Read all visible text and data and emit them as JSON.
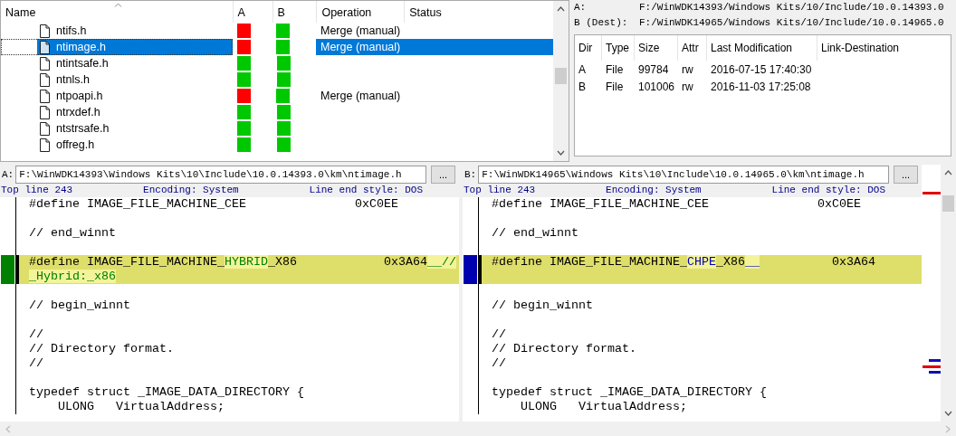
{
  "file_list": {
    "columns": [
      "Name",
      "A",
      "B",
      "Operation",
      "Status"
    ],
    "rows": [
      {
        "name": "ntifs.h",
        "a": {
          "color": "#ff0000"
        },
        "b": {
          "color": "#00c800"
        },
        "operation": "Merge (manual)",
        "selected": false
      },
      {
        "name": "ntimage.h",
        "a": {
          "color": "#ff0000"
        },
        "b": {
          "color": "#00c800"
        },
        "operation": "Merge (manual)",
        "selected": true
      },
      {
        "name": "ntintsafe.h",
        "a": {
          "color": "#00c800"
        },
        "b": {
          "color": "#00c800"
        },
        "selected": false
      },
      {
        "name": "ntnls.h",
        "a": {
          "color": "#00c800"
        },
        "b": {
          "color": "#00c800"
        },
        "selected": false
      },
      {
        "name": "ntpoapi.h",
        "a": {
          "color": "#ff0000"
        },
        "b": {
          "color": "#00c800"
        },
        "operation": "Merge (manual)",
        "selected": false
      },
      {
        "name": "ntrxdef.h",
        "a": {
          "color": "#00c800"
        },
        "b": {
          "color": "#00c800"
        },
        "selected": false
      },
      {
        "name": "ntstrsafe.h",
        "a": {
          "color": "#00c800"
        },
        "b": {
          "color": "#00c800"
        },
        "selected": false
      },
      {
        "name": "offreg.h",
        "a": {
          "color": "#00c800"
        },
        "b": {
          "color": "#00c800"
        },
        "selected": false
      }
    ]
  },
  "info": {
    "a_label": "A:",
    "a_path": "F:/WinWDK14393/Windows Kits/10/Include/10.0.14393.0",
    "b_label": "B (Dest):",
    "b_path": "F:/WinWDK14965/Windows Kits/10/Include/10.0.14965.0",
    "columns": [
      "Dir",
      "Type",
      "Size",
      "Attr",
      "Last Modification",
      "Link-Destination"
    ],
    "rows": [
      [
        "A",
        "File",
        "99784",
        "rw",
        "2016-07-15 17:40:30"
      ],
      [
        "B",
        "File",
        "101006",
        "rw",
        "2016-11-03 17:25:08"
      ]
    ]
  },
  "panes": [
    {
      "label": "A:",
      "path": "F:\\WinWDK14393\\Windows Kits\\10\\Include\\10.0.14393.0\\km\\ntimage.h",
      "button": "...",
      "top_line": "Top line 243",
      "encoding": "Encoding: System",
      "line_end": "Line end style: DOS",
      "marker": {
        "color": "#008000"
      },
      "lines": [
        {
          "kind": "text",
          "segments": [
            {
              "text": "#define IMAGE_FILE_MACHINE_CEE               0xC0EE",
              "changed": false
            }
          ]
        },
        {
          "kind": "blank"
        },
        {
          "kind": "text",
          "segments": [
            {
              "text": "// end_winnt",
              "changed": false
            }
          ]
        },
        {
          "kind": "blank"
        },
        {
          "kind": "diff",
          "segments": [
            {
              "text": "#define IMAGE_FILE_MACHINE_",
              "changed": false
            },
            {
              "text": "HYBRID",
              "changed": true
            },
            {
              "text": "_X86            0x3A64",
              "changed": false
            },
            {
              "text": "__//",
              "changed": true
            }
          ]
        },
        {
          "kind": "diff",
          "segments": [
            {
              "text": "_Hybrid:_x86",
              "changed": true
            }
          ]
        },
        {
          "kind": "blank"
        },
        {
          "kind": "text",
          "segments": [
            {
              "text": "// begin_winnt",
              "changed": false
            }
          ]
        },
        {
          "kind": "blank"
        },
        {
          "kind": "text",
          "segments": [
            {
              "text": "//",
              "changed": false
            }
          ]
        },
        {
          "kind": "text",
          "segments": [
            {
              "text": "// Directory format.",
              "changed": false
            }
          ]
        },
        {
          "kind": "text",
          "segments": [
            {
              "text": "//",
              "changed": false
            }
          ]
        },
        {
          "kind": "blank"
        },
        {
          "kind": "text",
          "segments": [
            {
              "text": "typedef struct _IMAGE_DATA_DIRECTORY {",
              "changed": false
            }
          ]
        },
        {
          "kind": "text",
          "segments": [
            {
              "text": "    ULONG   VirtualAddress;",
              "changed": false
            }
          ]
        }
      ]
    },
    {
      "label": "B:",
      "path": "F:\\WinWDK14965\\Windows Kits\\10\\Include\\10.0.14965.0\\km\\ntimage.h",
      "button": "...",
      "top_line": "Top line 243",
      "encoding": "Encoding: System",
      "line_end": "Line end style: DOS",
      "marker": {
        "color": "#0000b0"
      },
      "lines": [
        {
          "kind": "text",
          "segments": [
            {
              "text": "#define IMAGE_FILE_MACHINE_CEE               0xC0EE",
              "changed": false
            }
          ]
        },
        {
          "kind": "blank"
        },
        {
          "kind": "text",
          "segments": [
            {
              "text": "// end_winnt",
              "changed": false
            }
          ]
        },
        {
          "kind": "blank"
        },
        {
          "kind": "diff",
          "segments": [
            {
              "text": "#define IMAGE_FILE_MACHINE_",
              "changed": false
            },
            {
              "text": "CHPE",
              "changed": true
            },
            {
              "text": "_X86",
              "changed": false
            },
            {
              "text": "__",
              "changed": true
            },
            {
              "text": "          0x3A64",
              "changed": false
            }
          ]
        },
        {
          "kind": "diff"
        },
        {
          "kind": "blank"
        },
        {
          "kind": "text",
          "segments": [
            {
              "text": "// begin_winnt",
              "changed": false
            }
          ]
        },
        {
          "kind": "blank"
        },
        {
          "kind": "text",
          "segments": [
            {
              "text": "//",
              "changed": false
            }
          ]
        },
        {
          "kind": "text",
          "segments": [
            {
              "text": "// Directory format.",
              "changed": false
            }
          ]
        },
        {
          "kind": "text",
          "segments": [
            {
              "text": "//",
              "changed": false
            }
          ]
        },
        {
          "kind": "blank"
        },
        {
          "kind": "text",
          "segments": [
            {
              "text": "typedef struct _IMAGE_DATA_DIRECTORY {",
              "changed": false
            }
          ]
        },
        {
          "kind": "text",
          "segments": [
            {
              "text": "    ULONG   VirtualAddress;",
              "changed": false
            }
          ]
        }
      ]
    }
  ]
}
